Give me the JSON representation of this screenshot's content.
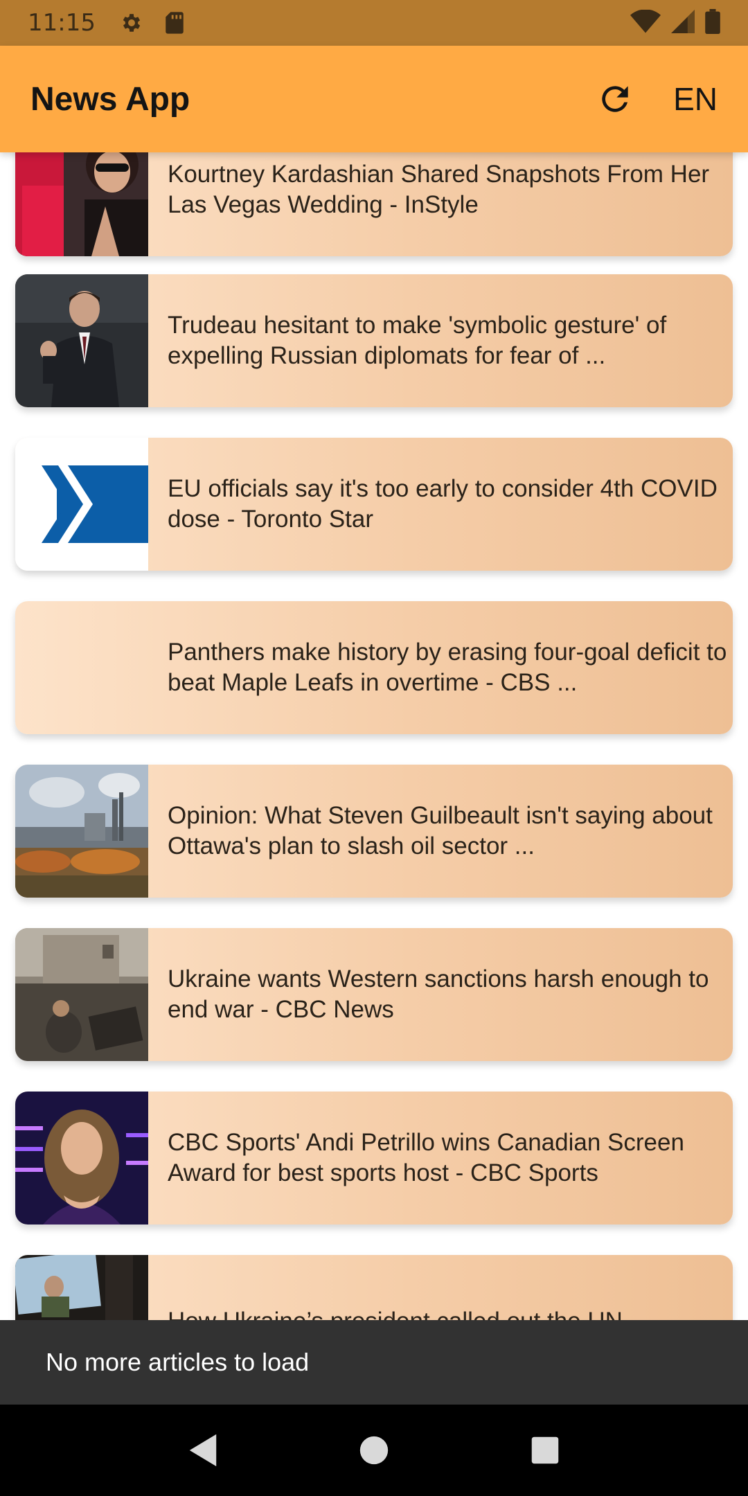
{
  "status": {
    "time": "11:15",
    "icons": [
      "settings-gear-icon",
      "sd-card-icon",
      "wifi-icon",
      "signal-icon",
      "battery-icon"
    ]
  },
  "app_bar": {
    "title": "News App",
    "refresh_icon": "refresh-icon",
    "language": "EN"
  },
  "articles": [
    {
      "title": "Kourtney Kardashian Shared Snapshots From Her Las Vegas Wedding - InStyle",
      "thumb": "photo-couple"
    },
    {
      "title": "Trudeau hesitant to make 'symbolic gesture' of expelling Russian diplomats for fear of ...",
      "thumb": "photo-trudeau"
    },
    {
      "title": "EU officials say it's too early to consider 4th COVID dose - Toronto Star",
      "thumb": "toronto-star-logo"
    },
    {
      "title": "Panthers make history by erasing four-goal deficit to beat Maple Leafs in overtime - CBS ...",
      "thumb": "none"
    },
    {
      "title": "Opinion: What Steven Guilbeault isn't saying about Ottawa's plan to slash oil sector ...",
      "thumb": "photo-refinery"
    },
    {
      "title": "Ukraine wants Western sanctions harsh enough to end war - CBC News",
      "thumb": "photo-ruins"
    },
    {
      "title": "CBC Sports' Andi Petrillo wins Canadian Screen Award for best sports host - CBC Sports",
      "thumb": "photo-host"
    },
    {
      "title": "How Ukraine’s president called out the UN",
      "thumb": "photo-zelensky"
    }
  ],
  "snackbar": {
    "message": "No more articles to load"
  },
  "nav": {
    "back_icon": "back-triangle-icon",
    "home_icon": "home-circle-icon",
    "recents_icon": "recents-square-icon"
  },
  "colors": {
    "status_bar": "#b57b2f",
    "app_bar": "#ffaa44",
    "card_gradient_start": "#fde3ca",
    "card_gradient_end": "#eebf94",
    "snackbar": "#323232",
    "nav_bar": "#000000"
  }
}
